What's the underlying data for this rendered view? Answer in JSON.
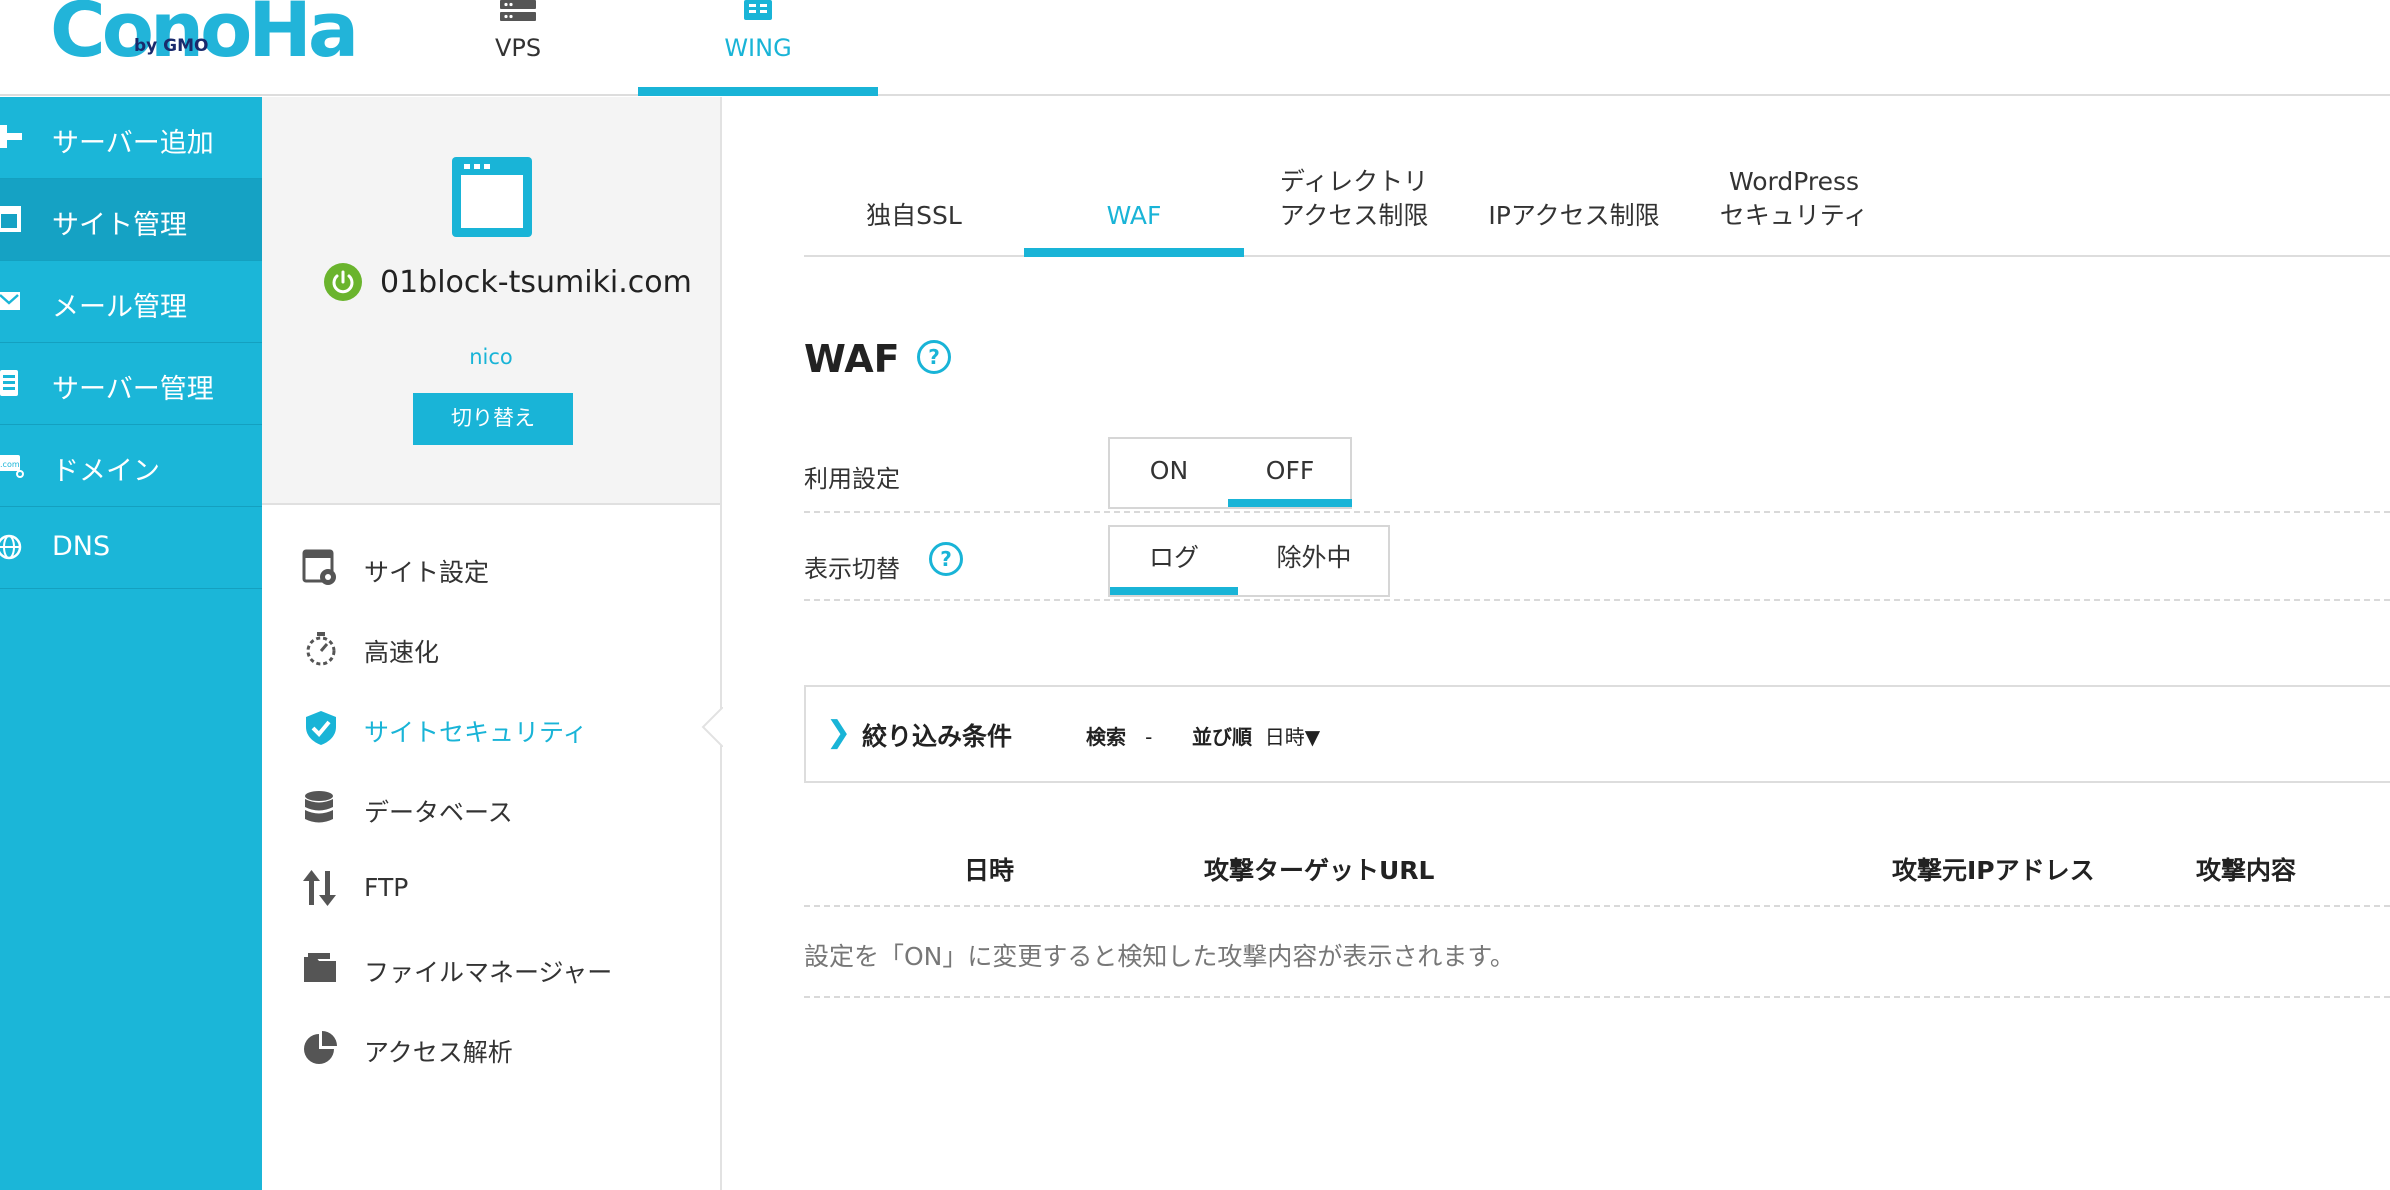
{
  "header": {
    "logo_text": "ConoHa",
    "logo_sub": "by GMO",
    "tabs": [
      {
        "label": "VPS",
        "icon": "server-icon",
        "active": false
      },
      {
        "label": "WING",
        "icon": "server-stack-icon",
        "active": true
      }
    ]
  },
  "sidebar": {
    "items": [
      {
        "label": "サーバー追加",
        "icon": "plus-icon",
        "active": false
      },
      {
        "label": "サイト管理",
        "icon": "window-icon",
        "active": true
      },
      {
        "label": "メール管理",
        "icon": "mail-icon",
        "active": false
      },
      {
        "label": "サーバー管理",
        "icon": "server-doc-icon",
        "active": false
      },
      {
        "label": "ドメイン",
        "icon": "domain-icon",
        "active": false
      },
      {
        "label": "DNS",
        "icon": "globe-icon",
        "active": false
      }
    ]
  },
  "site_panel": {
    "domain": "01block-tsumiki.com",
    "user": "nico",
    "switch_label": "切り替え",
    "menu": [
      {
        "label": "サイト設定",
        "icon": "site-settings-icon",
        "active": false
      },
      {
        "label": "高速化",
        "icon": "stopwatch-icon",
        "active": false
      },
      {
        "label": "サイトセキュリティ",
        "icon": "shield-check-icon",
        "active": true
      },
      {
        "label": "データベース",
        "icon": "database-icon",
        "active": false
      },
      {
        "label": "FTP",
        "icon": "transfer-arrows-icon",
        "active": false
      },
      {
        "label": "ファイルマネージャー",
        "icon": "folder-icon",
        "active": false
      },
      {
        "label": "アクセス解析",
        "icon": "pie-chart-icon",
        "active": false
      }
    ]
  },
  "main": {
    "tabs": [
      {
        "line1": "",
        "line2": "独自SSL",
        "active": false
      },
      {
        "line1": "",
        "line2": "WAF",
        "active": true
      },
      {
        "line1": "ディレクトリ",
        "line2": "アクセス制限",
        "active": false
      },
      {
        "line1": "",
        "line2": "IPアクセス制限",
        "active": false
      },
      {
        "line1": "WordPress",
        "line2": "セキュリティ",
        "active": false
      }
    ],
    "title": "WAF",
    "usage": {
      "label": "利用設定",
      "options": [
        "ON",
        "OFF"
      ],
      "selected": "OFF"
    },
    "display": {
      "label": "表示切替",
      "options": [
        "ログ",
        "除外中"
      ],
      "selected": "ログ"
    },
    "filter": {
      "title": "絞り込み条件",
      "search_label": "検索",
      "search_value": "-",
      "sort_label": "並び順",
      "sort_value": "日時▼"
    },
    "table": {
      "columns": [
        "日時",
        "攻撃ターゲットURL",
        "攻撃元IPアドレス",
        "攻撃内容"
      ],
      "empty_message": "設定を「ON」に変更すると検知した攻撃内容が表示されます。"
    }
  },
  "colors": {
    "accent": "#19b4d7",
    "sidebar_bg": "#1bb6d8",
    "sidebar_active": "#15a2c4",
    "power_green": "#6ab42d"
  }
}
